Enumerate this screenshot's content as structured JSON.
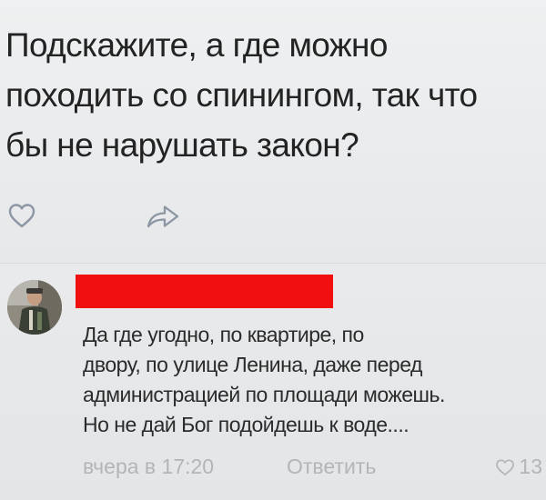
{
  "post": {
    "text": "Подскажите, а где можно\nпоходить со спинингом, так что\nбы не нарушать закон?",
    "icons": {
      "like": "heart-outline-icon",
      "share": "share-arrow-icon"
    }
  },
  "comment": {
    "author_redacted": true,
    "redaction_color": "#f20f0f",
    "text": "Да где угодно, по квартире, по\nдвору, по улице Ленина, даже перед\nадминистрацией по площади можешь.\nНо не дай Бог подойдешь к воде....",
    "time": "вчера в 17:20",
    "reply_label": "Ответить",
    "likes_count": "13"
  },
  "colors": {
    "text": "#232323",
    "muted": "#b3b5b8",
    "icon": "#8d96a3"
  }
}
